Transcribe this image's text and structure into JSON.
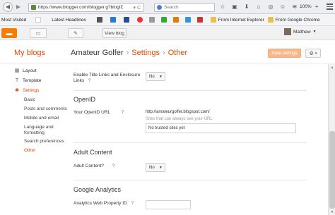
{
  "browser": {
    "url": "https://www.blogger.com/blogger.g?blogID=389",
    "search_placeholder": "Search",
    "zoom": "100%"
  },
  "bookmarks": [
    {
      "label": "Most Visited"
    },
    {
      "label": "Latest Headlines"
    },
    {
      "label": "From Internet Explorer"
    },
    {
      "label": "From Google Chrome"
    }
  ],
  "blogger_bar": {
    "view_blog": "View blog",
    "user_name": "Matthew"
  },
  "header": {
    "my_blogs": "My blogs",
    "blog_name": "Amateur Golfer",
    "separator": "›",
    "crumb_settings": "Settings",
    "crumb_other": "Other",
    "save_button": "Save settings"
  },
  "sidebar": {
    "items": [
      {
        "label": "Layout"
      },
      {
        "label": "Template"
      },
      {
        "label": "Settings"
      }
    ],
    "sub_items": [
      {
        "label": "Basic"
      },
      {
        "label": "Posts and comments"
      },
      {
        "label": "Mobile and email"
      },
      {
        "label": "Language and"
      },
      {
        "label": "formatting"
      },
      {
        "label": "Search preferences"
      },
      {
        "label": "Other"
      }
    ]
  },
  "main": {
    "title_links": {
      "label_line1": "Enable Title Links and Enclosure",
      "label_line2": "Links",
      "help": "?",
      "value": "No"
    },
    "openid": {
      "section_title": "OpenID",
      "field_label": "Your OpenID URL",
      "help": "?",
      "url": "http://amateurgolfer.blogspot.com/",
      "hint": "Sites that can always see your URL",
      "trusted_sites": "No trusted sites yet"
    },
    "adult_content": {
      "section_title": "Adult Content",
      "field_label": "Adult Content?",
      "help": "?",
      "value": "No"
    },
    "analytics": {
      "section_title": "Google Analytics",
      "field_label": "Analytics Web Property ID",
      "help": "?",
      "value": ""
    }
  }
}
